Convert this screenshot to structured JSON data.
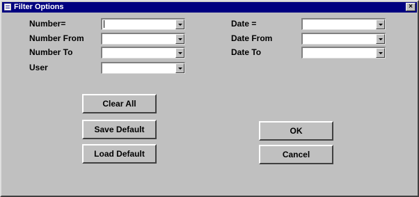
{
  "window": {
    "title": "Filter Options",
    "close_label": "×"
  },
  "icons": {
    "app": "form-icon",
    "close": "close-icon",
    "dropdown": "chevron-down-icon"
  },
  "fields": {
    "number_eq": {
      "label": "Number=",
      "value": ""
    },
    "number_from": {
      "label": "Number From",
      "value": ""
    },
    "number_to": {
      "label": "Number To",
      "value": ""
    },
    "user": {
      "label": "User",
      "value": ""
    },
    "date_eq": {
      "label": "Date =",
      "value": ""
    },
    "date_from": {
      "label": "Date From",
      "value": ""
    },
    "date_to": {
      "label": "Date To",
      "value": ""
    }
  },
  "buttons": {
    "clear_all": "Clear All",
    "save_default": "Save Default",
    "load_default": "Load Default",
    "ok": "OK",
    "cancel": "Cancel"
  }
}
